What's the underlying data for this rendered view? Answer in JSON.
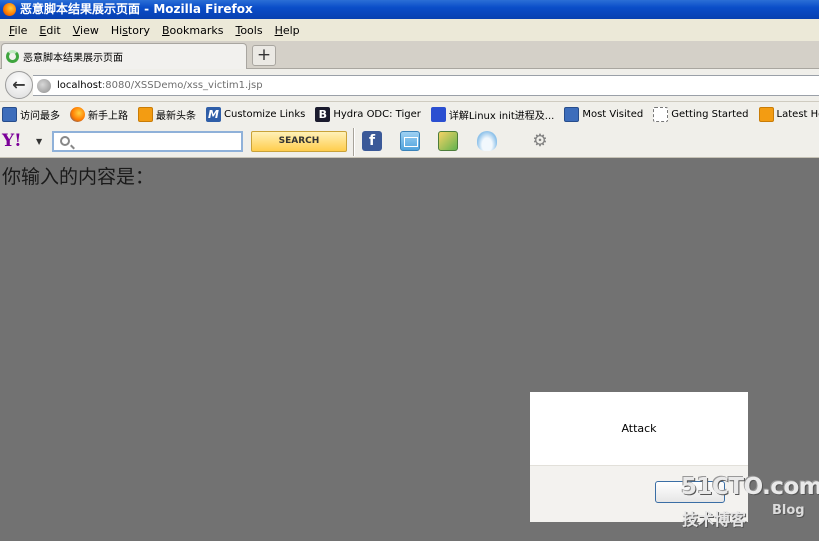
{
  "window": {
    "title": "恶意脚本结果展示页面 - Mozilla Firefox"
  },
  "menubar": {
    "items": [
      {
        "label": "File",
        "accel": "F"
      },
      {
        "label": "Edit",
        "accel": "E"
      },
      {
        "label": "View",
        "accel": "V"
      },
      {
        "label": "History",
        "accel": "s"
      },
      {
        "label": "Bookmarks",
        "accel": "B"
      },
      {
        "label": "Tools",
        "accel": "T"
      },
      {
        "label": "Help",
        "accel": "H"
      }
    ]
  },
  "tabs": {
    "active_title": "恶意脚本结果展示页面",
    "new_tab_label": "+"
  },
  "navbar": {
    "back_label": "←",
    "url_host": "localhost",
    "url_rest": ":8080/XSSDemo/xss_victim1.jsp"
  },
  "bookmarks": {
    "items": [
      {
        "label": "访问最多",
        "icon": "most-visited-icon"
      },
      {
        "label": "新手上路",
        "icon": "firefox-icon"
      },
      {
        "label": "最新头条",
        "icon": "rss-feed-icon"
      },
      {
        "label": "Customize Links",
        "icon": "m-letter-icon"
      },
      {
        "label": "Hydra ODC: Tiger",
        "icon": "b-letter-icon"
      },
      {
        "label": "详解Linux init进程及...",
        "icon": "paw-icon"
      },
      {
        "label": "Most Visited",
        "icon": "most-visited-icon"
      },
      {
        "label": "Getting Started",
        "icon": "blank-page-icon"
      },
      {
        "label": "Latest He",
        "icon": "rss-feed-icon"
      }
    ]
  },
  "yahoo_toolbar": {
    "logo": "Y!",
    "search_placeholder": "",
    "search_button": "SEARCH",
    "facebook_glyph": "f",
    "gear_glyph": "⚙"
  },
  "page": {
    "text": "你输入的内容是："
  },
  "alert": {
    "message": "Attack",
    "ok_label": ""
  },
  "watermark": {
    "main": "51CTO.com",
    "sub": "技术博客",
    "blog": "Blog"
  }
}
